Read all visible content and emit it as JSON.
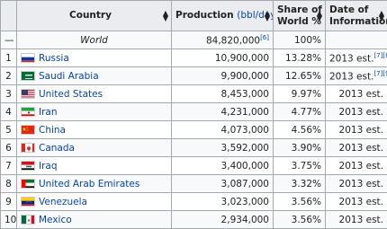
{
  "headers": {
    "country": "Country",
    "production": "Production",
    "production_unit": "(bbl/day)",
    "share_line1": "Share of",
    "share_line2": "World %",
    "date_line1": "Date of",
    "date_line2": "Information"
  },
  "world_row": {
    "rank": "—",
    "name": "World",
    "production": "84,820,000",
    "production_ref": "[6]",
    "share": "100%",
    "date": ""
  },
  "rows": [
    {
      "rank": "1",
      "country": "Russia",
      "flag": "russia-flag-icon",
      "production": "10,900,000",
      "share": "13.28%",
      "date": "2013 est.",
      "refs": "[7][8]"
    },
    {
      "rank": "2",
      "country": "Saudi Arabia",
      "flag": "saudi-arabia-flag-icon",
      "production": "9,900,000",
      "share": "12.65%",
      "date": "2013 est.",
      "refs": "[7][9]"
    },
    {
      "rank": "3",
      "country": "United States",
      "flag": "united-states-flag-icon",
      "production": "8,453,000",
      "share": "9.97%",
      "date": "2013 est.",
      "refs": ""
    },
    {
      "rank": "4",
      "country": "Iran",
      "flag": "iran-flag-icon",
      "production": "4,231,000",
      "share": "4.77%",
      "date": "2013 est.",
      "refs": ""
    },
    {
      "rank": "5",
      "country": "China",
      "flag": "china-flag-icon",
      "production": "4,073,000",
      "share": "4.56%",
      "date": "2013 est.",
      "refs": ""
    },
    {
      "rank": "6",
      "country": "Canada",
      "flag": "canada-flag-icon",
      "production": "3,592,000",
      "share": "3.90%",
      "date": "2013 est.",
      "refs": ""
    },
    {
      "rank": "7",
      "country": "Iraq",
      "flag": "iraq-flag-icon",
      "production": "3,400,000",
      "share": "3.75%",
      "date": "2013 est.",
      "refs": ""
    },
    {
      "rank": "8",
      "country": "United Arab Emirates",
      "flag": "uae-flag-icon",
      "production": "3,087,000",
      "share": "3.32%",
      "date": "2013 est.",
      "refs": ""
    },
    {
      "rank": "9",
      "country": "Venezuela",
      "flag": "venezuela-flag-icon",
      "production": "3,023,000",
      "share": "3.56%",
      "date": "2013 est.",
      "refs": ""
    },
    {
      "rank": "10",
      "country": "Mexico",
      "flag": "mexico-flag-icon",
      "production": "2,934,000",
      "share": "3.56%",
      "date": "2013 est.",
      "refs": ""
    }
  ],
  "sort_icon": "sort-arrows-icon"
}
